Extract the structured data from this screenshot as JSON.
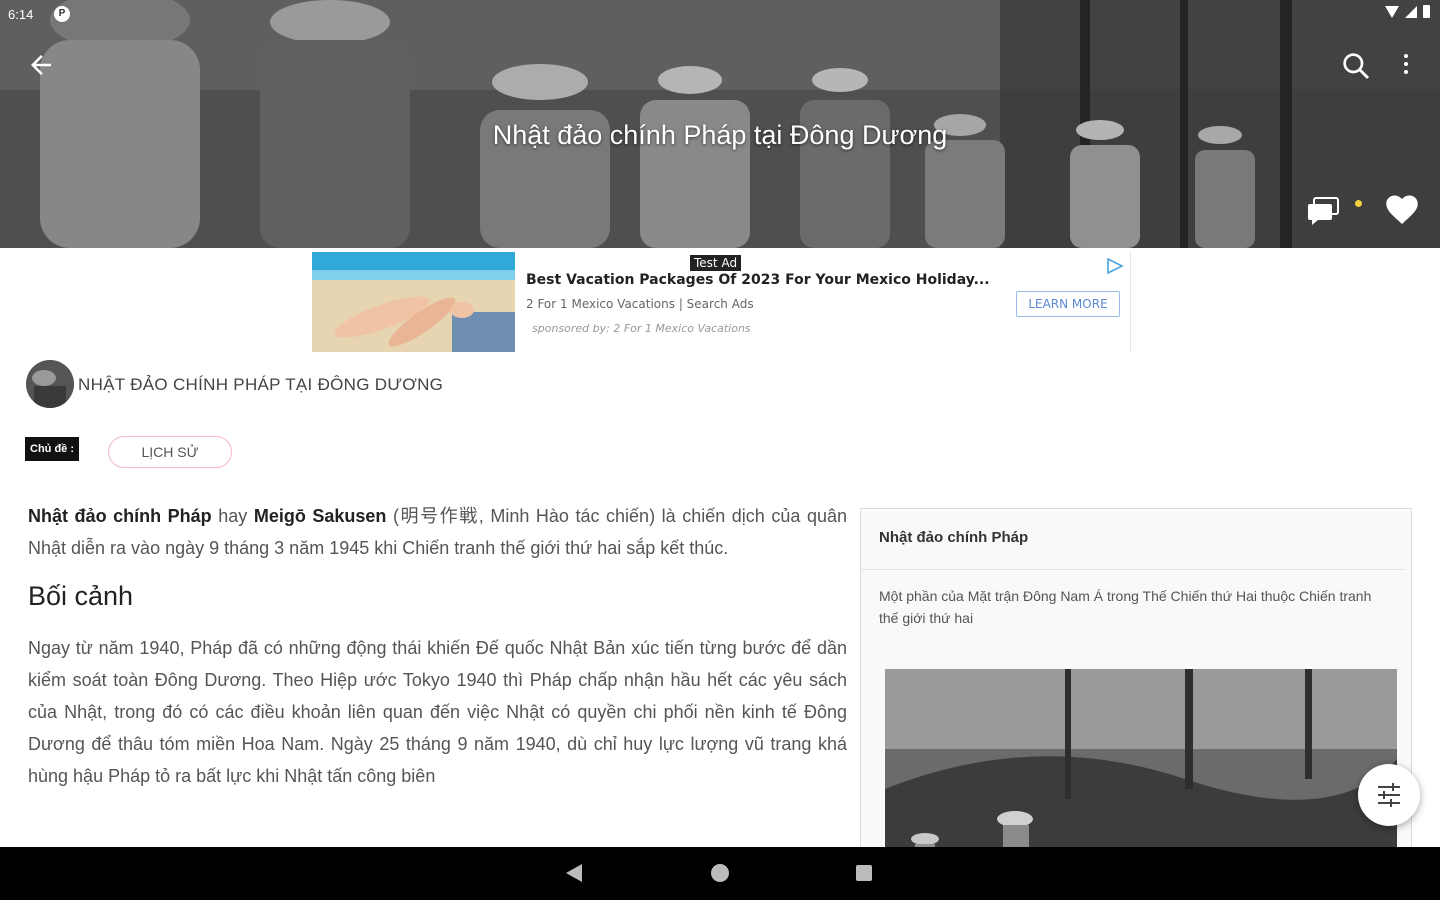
{
  "status": {
    "time": "6:14",
    "badge": "P"
  },
  "hero": {
    "title": "Nhật đảo chính Pháp tại Đông Dương"
  },
  "ad": {
    "label": "Test Ad",
    "title": "Best Vacation Packages Of 2023 For Your Mexico Holiday...",
    "subtitle": "2 For 1 Mexico Vacations | Search Ads",
    "sponsor": "sponsored by: 2 For 1 Mexico Vacations",
    "cta": "LEARN MORE"
  },
  "article": {
    "heading": "NHẬT ĐẢO CHÍNH PHÁP TẠI ĐÔNG DƯƠNG",
    "topic_label": "Chủ đề :",
    "topic": "LỊCH SỬ",
    "intro": {
      "term1": "Nhật đảo chính Pháp",
      "connector": " hay ",
      "term2": "Meigō Sakusen",
      "rest": " (明号作戦, Minh Hào tác chiến) là chiến dịch của quân Nhật diễn ra vào ngày 9 tháng 3 năm 1945 khi Chiến tranh thế giới thứ hai sắp kết thúc."
    },
    "section_heading": "Bối cảnh",
    "paragraph": "Ngay từ năm 1940, Pháp đã có những động thái khiến Đế quốc Nhật Bản xúc tiến từng bước để dần kiểm soát toàn Đông Dương. Theo Hiệp ước Tokyo 1940 thì Pháp chấp nhận hầu hết các yêu sách của Nhật, trong đó có các điều khoản liên quan đến việc Nhật có quyền chi phối nền kinh tế Đông Dương để thâu tóm miền Hoa Nam. Ngày 25 tháng 9 năm 1940, dù chỉ huy lực lượng vũ trang khá hùng hậu Pháp tỏ ra bất lực khi Nhật tấn công biên"
  },
  "infobox": {
    "title": "Nhật đảo chính Pháp",
    "subtitle": "Một phần của Mặt trận Đông Nam Á trong Thế Chiến thứ Hai thuộc Chiến tranh thế giới thứ hai"
  },
  "colors": {
    "topic_border": "#f4b9c1",
    "ad_cta": "#5a8ad8",
    "hero_overlay": "#4a4a4a"
  },
  "icons": {
    "back": "arrow-left-icon",
    "search": "search-icon",
    "more": "more-vert-icon",
    "comment": "comment-icon",
    "heart": "heart-icon",
    "filter": "tune-icon"
  }
}
